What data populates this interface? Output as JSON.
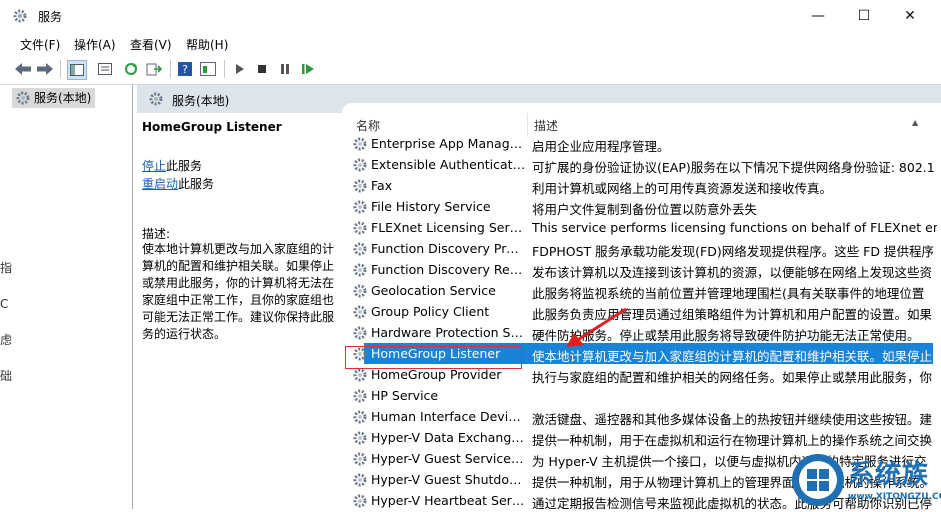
{
  "window": {
    "title": "服务",
    "minimize": "—",
    "maximize": "☐",
    "close": "✕"
  },
  "menu": [
    "文件(F)",
    "操作(A)",
    "查看(V)",
    "帮助(H)"
  ],
  "toolbar": {
    "icons": [
      "back-icon",
      "forward-icon",
      "console-tree-icon",
      "properties-icon",
      "refresh-icon",
      "export-icon",
      "help-icon",
      "view-icon",
      "start-icon",
      "stop-icon",
      "pause-icon",
      "restart-icon"
    ]
  },
  "tree": {
    "root_label": "服务(本地)"
  },
  "edge_chars": [
    "指",
    "C",
    "虑",
    "础"
  ],
  "header": {
    "title": "服务(本地)"
  },
  "details": {
    "service_name": "HomeGroup Listener",
    "stop_link": "停止",
    "stop_suffix": "此服务",
    "restart_link": "重启动",
    "restart_suffix": "此服务",
    "desc_label": "描述:",
    "desc_text": "使本地计算机更改与加入家庭组的计算机的配置和维护相关联。如果停止或禁用此服务，你的计算机将无法在家庭组中正常工作，且你的家庭组也可能无法正常工作。建议你保持此服务的运行状态。"
  },
  "columns": {
    "name": "名称",
    "description": "描述"
  },
  "services": [
    {
      "name": "Enterprise App Manage...",
      "desc": "启用企业应用程序管理。"
    },
    {
      "name": "Extensible Authentication...",
      "desc": "可扩展的身份验证协议(EAP)服务在以下情况下提供网络身份验证: 802.1"
    },
    {
      "name": "Fax",
      "desc": "利用计算机或网络上的可用传真资源发送和接收传真。"
    },
    {
      "name": "File History Service",
      "desc": "将用户文件复制到备份位置以防意外丢失"
    },
    {
      "name": "FLEXnet Licensing Service",
      "desc": "This service performs licensing functions on behalf of FLEXnet en"
    },
    {
      "name": "Function Discovery Provi...",
      "desc": "FDPHOST 服务承载功能发现(FD)网络发现提供程序。这些 FD 提供程序"
    },
    {
      "name": "Function Discovery Reso...",
      "desc": "发布该计算机以及连接到该计算机的资源，以便能够在网络上发现这些资"
    },
    {
      "name": "Geolocation Service",
      "desc": "此服务将监视系统的当前位置并管理地理围栏(具有关联事件的地理位置"
    },
    {
      "name": "Group Policy Client",
      "desc": "此服务负责应用管理员通过组策略组件为计算机和用户配置的设置。如果"
    },
    {
      "name": "Hardware Protection Ser...",
      "desc": "硬件防护服务。停止或禁用此服务将导致硬件防护功能无法正常使用。"
    },
    {
      "name": "HomeGroup Listener",
      "desc": "使本地计算机更改与加入家庭组的计算机的配置和维护相关联。如果停止"
    },
    {
      "name": "HomeGroup Provider",
      "desc": "执行与家庭组的配置和维护相关的网络任务。如果停止或禁用此服务，你"
    },
    {
      "name": "HP Service",
      "desc": ""
    },
    {
      "name": "Human Interface Device ...",
      "desc": "激活键盘、遥控器和其他多媒体设备上的热按钮并继续使用这些按钮。建"
    },
    {
      "name": "Hyper-V Data Exchange ...",
      "desc": "提供一种机制，用于在虚拟机和运行在物理计算机上的操作系统之间交换"
    },
    {
      "name": "Hyper-V Guest Service In...",
      "desc": "为 Hyper-V 主机提供一个接口，以便与虚拟机内运行的特定服务进行交"
    },
    {
      "name": "Hyper-V Guest Shutdown...",
      "desc": "提供一种机制，用于从物理计算机上的管理界面关闭虚拟机的操作系统。"
    },
    {
      "name": "Hyper-V Heartbeat Service",
      "desc": "通过定期报告检测信号来监视此虚拟机的状态。此服务可帮助你识别已停"
    }
  ],
  "selected_index": 10,
  "watermark": {
    "text": "系统族",
    "url": "www.XITONGZU.COM"
  },
  "colors": {
    "selection": "#1883d7",
    "header_band": "#dde4ec",
    "link": "#1a5fb4",
    "highlight_box": "#e03030"
  }
}
